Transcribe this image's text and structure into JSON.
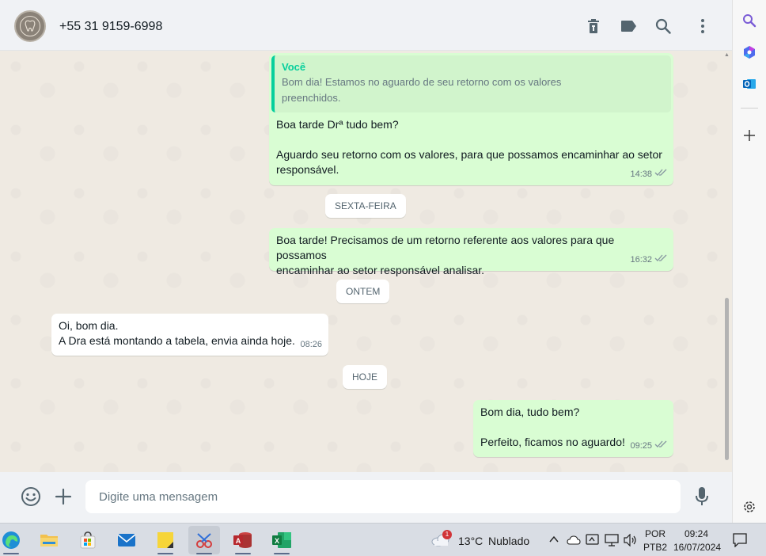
{
  "header": {
    "contact_name": "+55 31 9159-6998",
    "icons": [
      "delete-icon",
      "label-icon",
      "search-icon",
      "menu-icon"
    ]
  },
  "messages": {
    "m1": {
      "quote_author": "Você",
      "quote_line1": "Bom dia! Estamos no aguardo de seu retorno com os valores",
      "quote_line2": "preenchidos.",
      "line1": "Boa tarde Drª tudo bem?",
      "line2": "Aguardo seu retorno com os valores, para que possamos encaminhar ao setor",
      "line3": "responsável.",
      "time": "14:38"
    },
    "chip1": "SEXTA-FEIRA",
    "m2": {
      "line1": "Boa tarde! Precisamos de um retorno referente aos valores para que possamos",
      "line2": "encaminhar ao setor responsável analisar.",
      "time": "16:32"
    },
    "chip2": "ONTEM",
    "m3": {
      "line1": "Oi, bom dia.",
      "line2": "A Dra está montando a tabela, envia ainda hoje.",
      "time": "08:26"
    },
    "chip3": "HOJE",
    "m4": {
      "line1": "Bom dia, tudo bem?",
      "line2": "Perfeito, ficamos no aguardo!",
      "time": "09:25"
    }
  },
  "footer": {
    "placeholder": "Digite uma mensagem"
  },
  "taskbar": {
    "weather_temp": "13°C",
    "weather_desc": "Nublado",
    "weather_badge": "1",
    "lang1": "POR",
    "lang2": "PTB2",
    "time": "09:24",
    "date": "16/07/2024"
  },
  "colors": {
    "outgoing_bubble": "#d9fdd3",
    "incoming_bubble": "#ffffff",
    "accent": "#06cf9c",
    "chat_bg": "#efeae2",
    "read_tick": "#667781"
  }
}
